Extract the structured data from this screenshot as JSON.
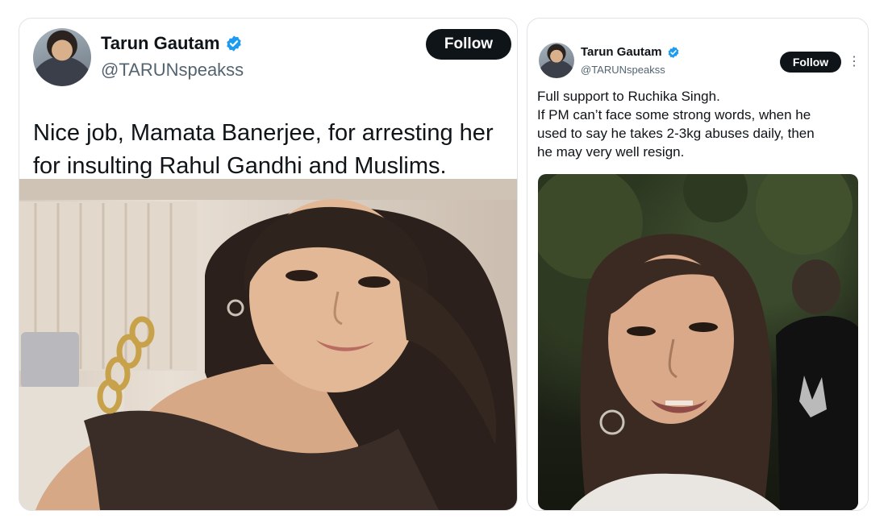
{
  "left_tweet": {
    "author_name": "Tarun Gautam",
    "author_handle": "@TARUNspeakss",
    "follow_label": "Follow",
    "text": "Nice job, Mamata Banerjee, for arresting her\nfor insulting Rahul Gandhi and Muslims.",
    "verified_icon": "verified-badge-icon",
    "colors": {
      "verified": "#1d9bf0",
      "follow_bg": "#0f1419",
      "follow_text": "#ffffff"
    }
  },
  "right_tweet": {
    "author_name": "Tarun Gautam",
    "author_handle": "@TARUNspeakss",
    "follow_label": "Follow",
    "more_label": "⋮",
    "text": "Full support to Ruchika Singh.\nIf PM can’t face some strong words, when he\nused to say he takes 2-3kg abuses daily, then\nhe may very well resign.",
    "verified_icon": "verified-badge-icon",
    "more_icon": "more-options-icon"
  }
}
